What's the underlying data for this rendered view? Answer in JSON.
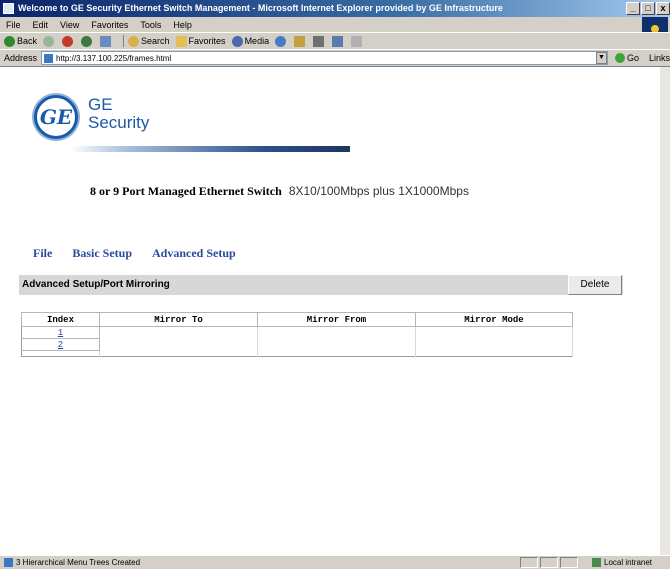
{
  "browser": {
    "title": "Welcome to GE Security Ethernet Switch Management - Microsoft Internet Explorer provided by GE Infrastructure",
    "window_buttons": {
      "minimize": "_",
      "maximize": "□",
      "close": "x"
    },
    "menu": [
      "File",
      "Edit",
      "View",
      "Favorites",
      "Tools",
      "Help"
    ],
    "toolbar": {
      "back": "Back",
      "search": "Search",
      "favorites": "Favorites",
      "media": "Media"
    },
    "address_label": "Address",
    "url": "http://3.137.100.225/frames.html",
    "go_label": "Go",
    "links_label": "Links",
    "status_text": "3 Hierarchical Menu Trees Created",
    "zone": "Local intranet"
  },
  "logo": {
    "mark": "GE",
    "line1": "GE",
    "line2": "Security"
  },
  "product": {
    "name": "8 or 9 Port Managed Ethernet Switch",
    "spec": "8X10/100Mbps plus 1X1000Mbps"
  },
  "nav": [
    "File",
    "Basic Setup",
    "Advanced Setup"
  ],
  "section": {
    "title": "Advanced Setup/Port Mirroring",
    "delete_label": "Delete"
  },
  "table": {
    "headers": [
      "Index",
      "Mirror To",
      "Mirror From",
      "Mirror Mode"
    ],
    "rows": [
      {
        "index": "1"
      },
      {
        "index": "2"
      }
    ]
  }
}
